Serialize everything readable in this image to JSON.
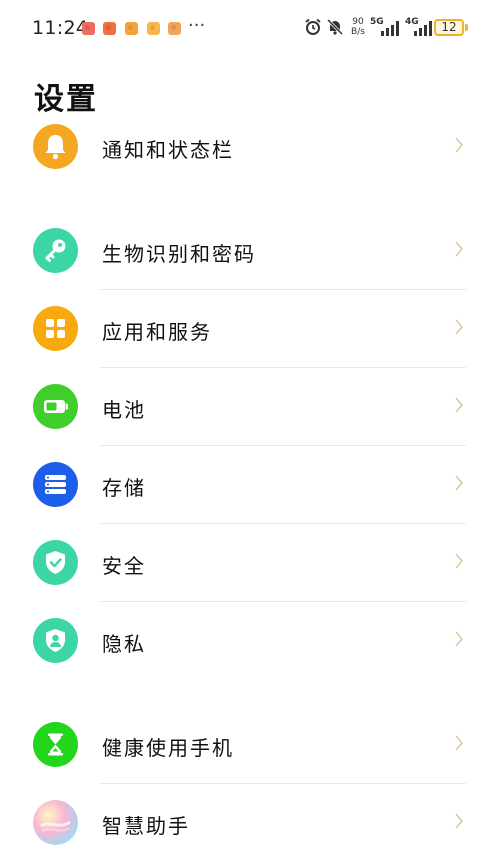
{
  "status_bar": {
    "time": "11:24",
    "more_indicator": "···",
    "net_speed_value": "90",
    "net_speed_unit": "B/s",
    "signal_5g_label": "5G",
    "signal_4g_label": "4G",
    "battery_level": "12",
    "battery_color": "#f1b22a",
    "icons": [
      "notification-icon",
      "notification-icon",
      "notification-icon",
      "notification-icon",
      "notification-icon",
      "alarm-icon",
      "mute-icon",
      "signal-icon",
      "signal-icon",
      "battery-icon"
    ]
  },
  "page": {
    "title": "设置"
  },
  "settings": {
    "items": [
      {
        "label": "通知和状态栏",
        "icon": "bell-icon",
        "color": "#f5a623"
      },
      {
        "label": "生物识别和密码",
        "icon": "key-icon",
        "color": "#3cd6a6"
      },
      {
        "label": "应用和服务",
        "icon": "apps-grid-icon",
        "color": "#f7a90f"
      },
      {
        "label": "电池",
        "icon": "battery-icon",
        "color": "#3fce2b"
      },
      {
        "label": "存储",
        "icon": "storage-icon",
        "color": "#1d5ee8"
      },
      {
        "label": "安全",
        "icon": "shield-check-icon",
        "color": "#3cd6a6"
      },
      {
        "label": "隐私",
        "icon": "privacy-shield-icon",
        "color": "#3cd6a6"
      },
      {
        "label": "健康使用手机",
        "icon": "hourglass-icon",
        "color": "#22d61d"
      },
      {
        "label": "智慧助手",
        "icon": "assistant-orb-icon",
        "color": "#f2a7c8"
      }
    ]
  },
  "colors": {
    "chevron": "#d9c9a3",
    "divider": "#efe9db"
  }
}
